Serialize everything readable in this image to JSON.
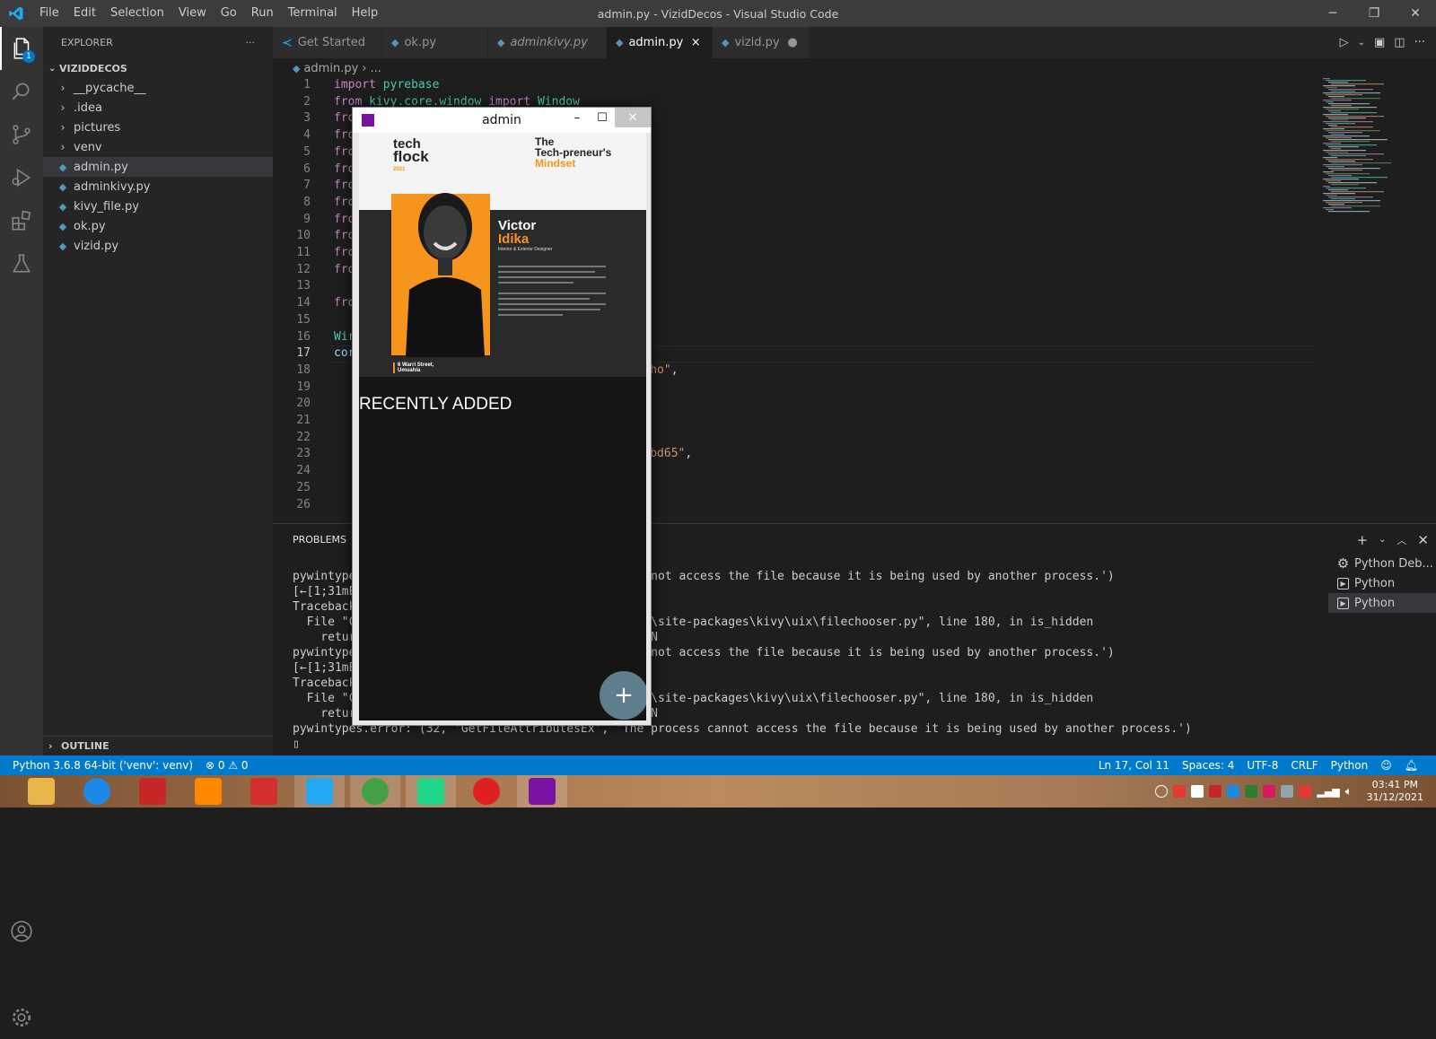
{
  "titlebar": {
    "menus": [
      "File",
      "Edit",
      "Selection",
      "View",
      "Go",
      "Run",
      "Terminal",
      "Help"
    ],
    "window_title": "admin.py - VizidDecos - Visual Studio Code"
  },
  "activity_badge": "1",
  "explorer": {
    "header": "EXPLORER",
    "more": "···",
    "project": "VIZIDDECOS",
    "items": [
      {
        "label": "__pycache__",
        "type": "folder"
      },
      {
        "label": ".idea",
        "type": "folder"
      },
      {
        "label": "pictures",
        "type": "folder"
      },
      {
        "label": "venv",
        "type": "folder"
      },
      {
        "label": "admin.py",
        "type": "file",
        "active": true
      },
      {
        "label": "adminkivy.py",
        "type": "file"
      },
      {
        "label": "kivy_file.py",
        "type": "file"
      },
      {
        "label": "ok.py",
        "type": "file"
      },
      {
        "label": "vizid.py",
        "type": "file"
      }
    ],
    "outline": "OUTLINE"
  },
  "tabs": [
    {
      "label": "Get Started",
      "icon": "vscode-icon"
    },
    {
      "label": "ok.py",
      "icon": "python-icon"
    },
    {
      "label": "adminkivy.py",
      "icon": "python-icon"
    },
    {
      "label": "admin.py",
      "icon": "python-icon",
      "active": true,
      "close": "×"
    },
    {
      "label": "vizid.py",
      "icon": "python-icon",
      "modified": "●"
    }
  ],
  "breadcrumb": {
    "file": "admin.py",
    "rest": "..."
  },
  "editor": {
    "current_line": 17,
    "lines": [
      {
        "n": "1",
        "html": "<span class='kw'>import</span> <span class='id'>pyrebase</span>"
      },
      {
        "n": "2",
        "html": "<span class='kw'>from</span> <span class='id'>kivy.core.window</span> <span class='kw'>import</span> <span class='id'>Window</span>"
      },
      {
        "n": "3",
        "html": "<span class='kw'>fro</span>"
      },
      {
        "n": "4",
        "html": "<span class='kw'>fro</span>"
      },
      {
        "n": "5",
        "html": "<span class='kw'>fro</span>"
      },
      {
        "n": "6",
        "html": "<span class='kw'>fro</span>"
      },
      {
        "n": "7",
        "html": "<span class='kw'>fro</span>"
      },
      {
        "n": "8",
        "html": "<span class='kw'>fro</span>"
      },
      {
        "n": "9",
        "html": "<span class='kw'>fro</span>"
      },
      {
        "n": "10",
        "html": "<span class='kw'>fro</span>"
      },
      {
        "n": "11",
        "html": "<span class='kw'>fro</span>"
      },
      {
        "n": "12",
        "html": "<span class='kw'>fro</span>"
      },
      {
        "n": "13",
        "html": ""
      },
      {
        "n": "14",
        "html": "<span class='kw'>fro</span>"
      },
      {
        "n": "15",
        "html": ""
      },
      {
        "n": "16",
        "html": "<span class='id'>Wir</span>"
      },
      {
        "n": "17",
        "html": "<span class='vb'>cor</span>"
      },
      {
        "n": "18",
        "html": "                                       <span class='str'>pTGugxho\"</span>,"
      },
      {
        "n": "19",
        "html": "                                       <span class='str'>\"</span>,"
      },
      {
        "n": "20",
        "html": ""
      },
      {
        "n": "21",
        "html": "                                       ,"
      },
      {
        "n": "22",
        "html": ""
      },
      {
        "n": "23",
        "html": "                                       <span class='str'>59fe00bd65\"</span>,"
      },
      {
        "n": "24",
        "html": "                                       ,"
      },
      {
        "n": "25",
        "html": "                                       ,"
      },
      {
        "n": "26",
        "html": ""
      }
    ]
  },
  "panel": {
    "tab": "PROBLEMS",
    "terminal_lines": [
      "pywintypes                                      cannot access the file because it is being used by another process.')",
      "[←[1;31mER                                      >",
      "Traceback",
      "  File \"C:                                     \\lib\\site-packages\\kivy\\uix\\filechooser.py\", line 180, in is_hidden",
      "    return                                     IDDEN",
      "pywintypes                                      cannot access the file because it is being used by another process.')",
      "[←[1;31mER                                      >",
      "Traceback",
      "  File \"C:                                     \\lib\\site-packages\\kivy\\uix\\filechooser.py\", line 180, in is_hidden",
      "    return                                     IDDEN",
      "pywintypes.error: (32, 'GetFileAttributesEx', 'The process cannot access the file because it is being used by another process.')",
      "▯"
    ],
    "terminals": [
      {
        "label": "Python Deb...",
        "icon": "debug-gear-icon"
      },
      {
        "label": "Python",
        "icon": "terminal-icon"
      },
      {
        "label": "Python",
        "icon": "terminal-icon",
        "selected": true
      }
    ]
  },
  "status": {
    "interpreter": "Python 3.6.8 64-bit ('venv': venv)",
    "problems": "⊗ 0 ⚠ 0",
    "position": "Ln 17, Col 11",
    "spaces": "Spaces: 4",
    "encoding": "UTF-8",
    "eol": "CRLF",
    "language": "Python"
  },
  "taskbar": {
    "apps": [
      {
        "name": "file-explorer",
        "color": "#e8b64a"
      },
      {
        "name": "internet-explorer",
        "color": "#1e88e5"
      },
      {
        "name": "game-app",
        "color": "#c62828"
      },
      {
        "name": "vlc",
        "color": "#ff8800"
      },
      {
        "name": "downloader",
        "color": "#d32f2f"
      },
      {
        "name": "vscode",
        "color": "#23a9f2",
        "open": true
      },
      {
        "name": "chrome",
        "color": "#43a047",
        "open": true
      },
      {
        "name": "pycharm",
        "color": "#21d789",
        "open": true
      },
      {
        "name": "opera",
        "color": "#e02020"
      },
      {
        "name": "kivy-app",
        "color": "#7a12a6",
        "open": true
      }
    ],
    "time": "03:41 PM",
    "date": "31/12/2021"
  },
  "kivy": {
    "title": "admin",
    "minimize": "–",
    "maximize": "☐",
    "close": "✕",
    "poster": {
      "logo_top": "tech",
      "logo_bottom": "flock",
      "logo_year": "2021",
      "headline1": "The",
      "headline2": "Tech-preneur's",
      "headline3": "Mindset",
      "name_first": "Victor",
      "name_last": "Idika",
      "role": "Interior & Exterior Designer",
      "address": "6 Warri Street, Umuahia"
    },
    "recent_label": "RECENTLY ADDED",
    "fab_label": "+"
  }
}
